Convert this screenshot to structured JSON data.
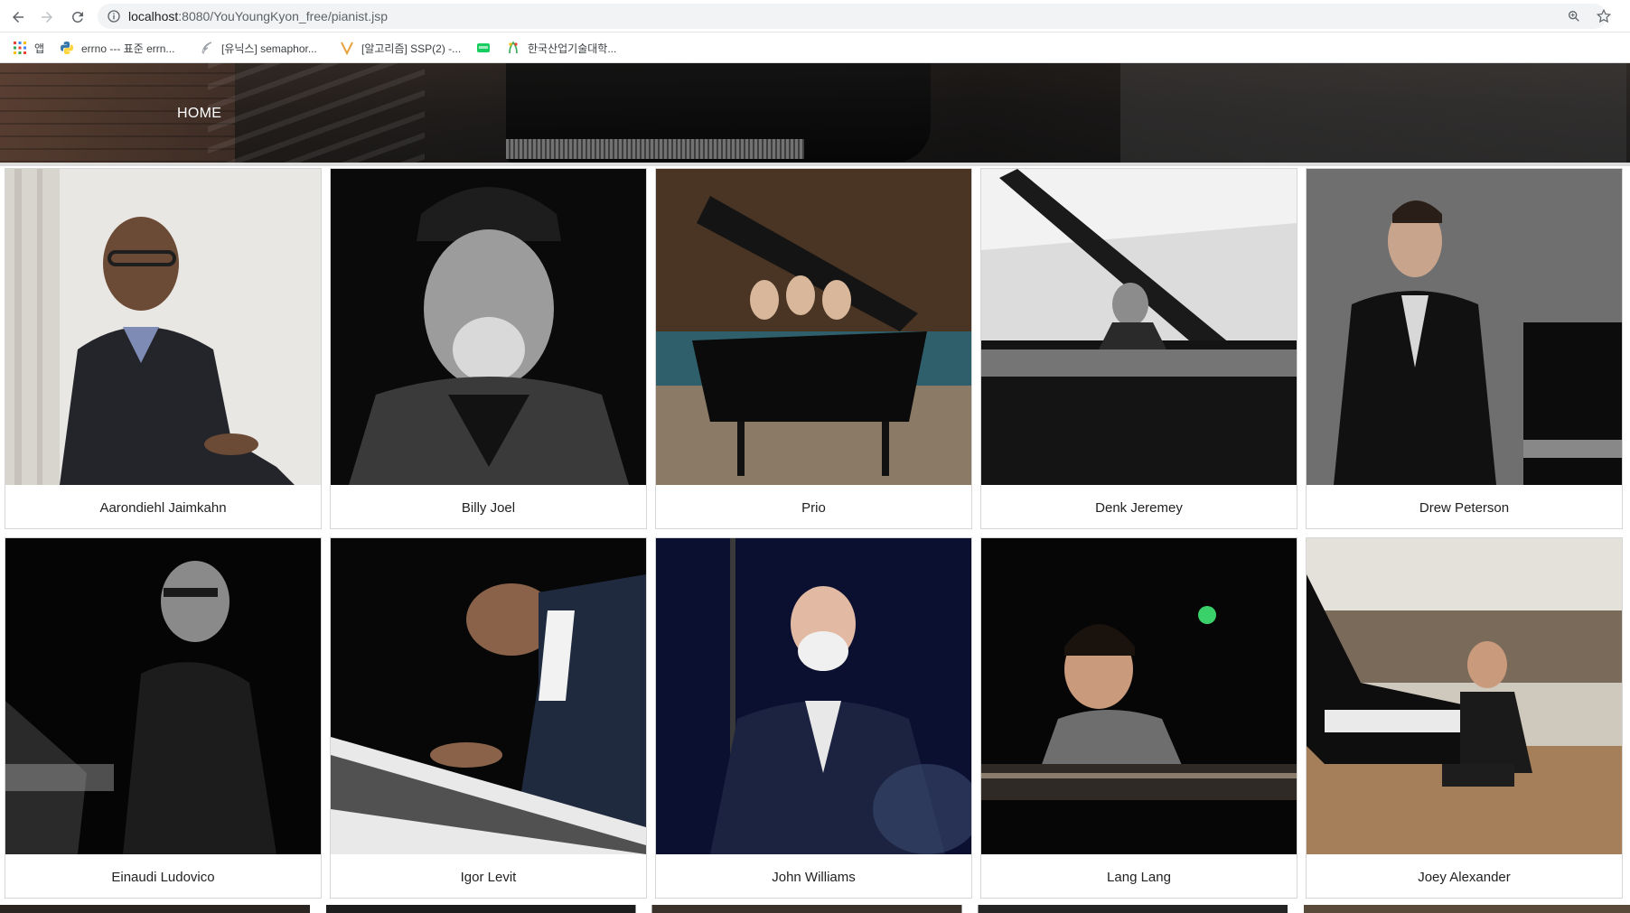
{
  "browser": {
    "url_host": "localhost",
    "url_path": ":8080/YouYoungKyon_free/pianist.jsp",
    "bookmarks": [
      {
        "label": "앱",
        "icon": "apps-grid-icon"
      },
      {
        "label": "errno --- 표준 errn...",
        "icon": "python-logo-icon"
      },
      {
        "label": "[유닉스] semaphor...",
        "icon": "feather-icon"
      },
      {
        "label": "[알고리즘] SSP(2) -...",
        "icon": "v-logo-icon"
      },
      {
        "label": "",
        "icon": "blog-logo-icon"
      },
      {
        "label": "한국산업기술대학...",
        "icon": "university-logo-icon"
      }
    ]
  },
  "header": {
    "home_label": "HOME"
  },
  "pianists": [
    {
      "name": "Aarondiehl Jaimkahn",
      "tone": "light"
    },
    {
      "name": "Billy Joel",
      "tone": "dark"
    },
    {
      "name": "Prio",
      "tone": "warm"
    },
    {
      "name": "Denk Jeremey",
      "tone": "bw"
    },
    {
      "name": "Drew Peterson",
      "tone": "grey"
    },
    {
      "name": "Einaudi Ludovico",
      "tone": "dark"
    },
    {
      "name": "Igor Levit",
      "tone": "dark"
    },
    {
      "name": "John Williams",
      "tone": "navy"
    },
    {
      "name": "Lang Lang",
      "tone": "dark"
    },
    {
      "name": "Joey Alexander",
      "tone": "hall"
    }
  ],
  "colors": {
    "name_text": "#222222",
    "card_border": "#d6d6d6",
    "hero_text": "#ffffff"
  }
}
